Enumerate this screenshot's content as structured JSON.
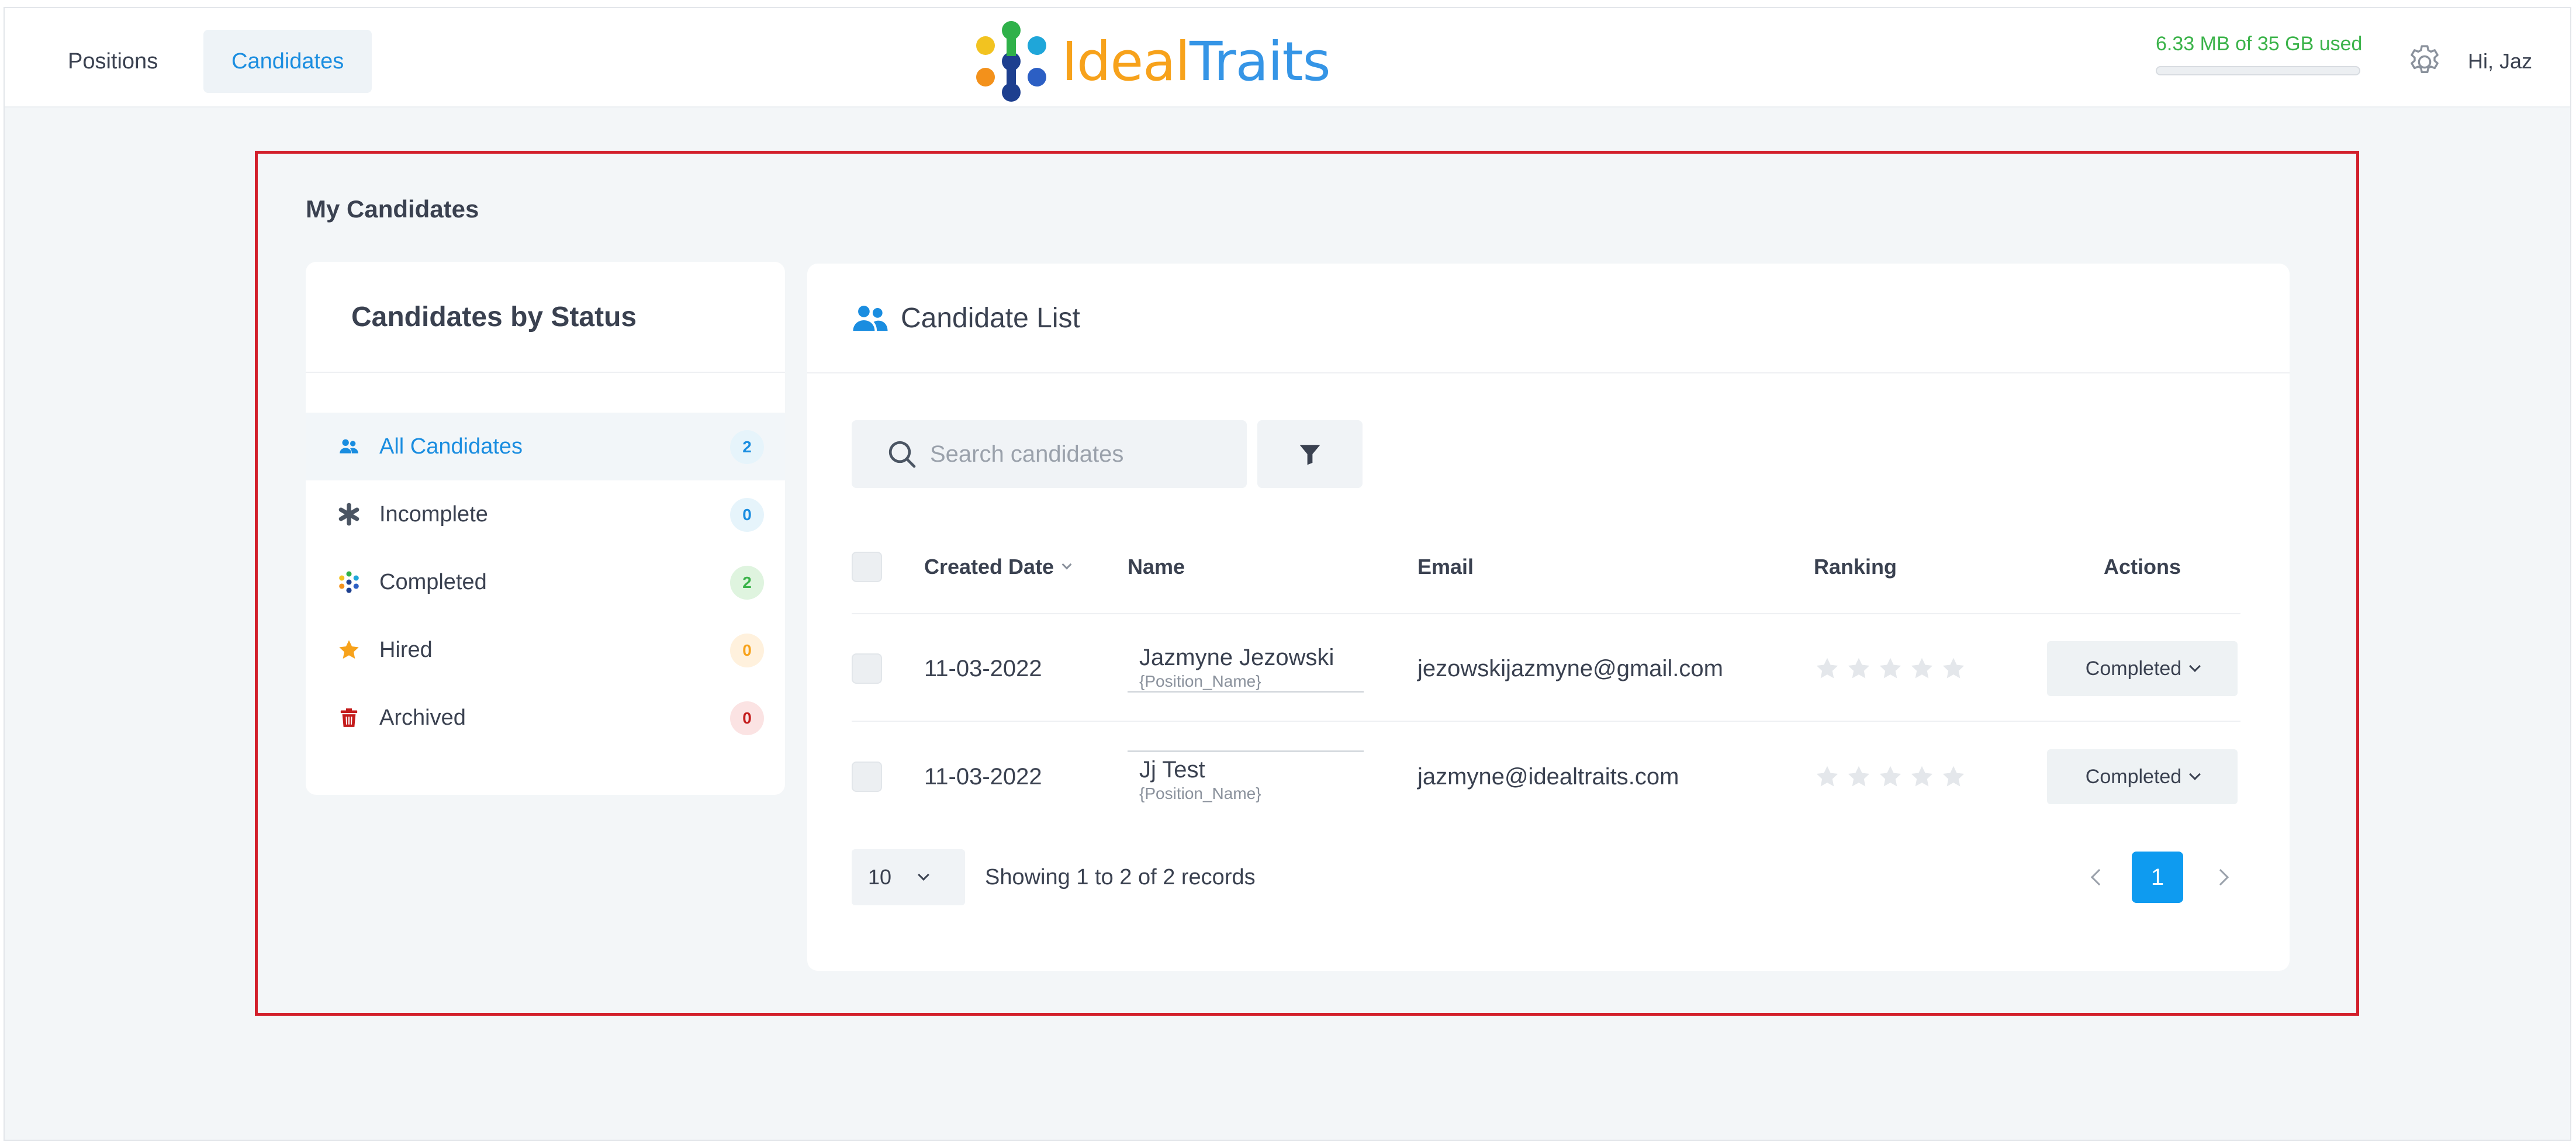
{
  "nav": {
    "positions_label": "Positions",
    "candidates_label": "Candidates"
  },
  "logo": {
    "word1": "Ideal",
    "word2": "Traits"
  },
  "storage": {
    "text": "6.33 MB of 35 GB used",
    "used_fraction": 0.0002
  },
  "user": {
    "greeting": "Hi, Jaz"
  },
  "page": {
    "title": "My Candidates"
  },
  "status_panel": {
    "title": "Candidates by Status",
    "items": [
      {
        "label": "All Candidates",
        "count": "2",
        "icon": "users-icon"
      },
      {
        "label": "Incomplete",
        "count": "0",
        "icon": "asterisk-icon"
      },
      {
        "label": "Completed",
        "count": "2",
        "icon": "flower-icon"
      },
      {
        "label": "Hired",
        "count": "0",
        "icon": "star-icon"
      },
      {
        "label": "Archived",
        "count": "0",
        "icon": "trash-icon"
      }
    ]
  },
  "candidate_list": {
    "title": "Candidate List",
    "search_placeholder": "Search candidates",
    "columns": {
      "created_date": "Created Date",
      "name": "Name",
      "email": "Email",
      "ranking": "Ranking",
      "actions": "Actions"
    },
    "rows": [
      {
        "date": "11-03-2022",
        "name": "Jazmyne Jezowski",
        "position": "{Position_Name}",
        "email": "jezowskijazmyne@gmail.com",
        "ranking": 0,
        "action": "Completed"
      },
      {
        "date": "11-03-2022",
        "name": "Jj Test",
        "position": "{Position_Name}",
        "email": "jazmyne@idealtraits.com",
        "ranking": 0,
        "action": "Completed"
      }
    ],
    "page_size": "10",
    "showing": "Showing 1 to 2 of 2 records",
    "current_page": "1"
  },
  "colors": {
    "accent_blue": "#1a8de0",
    "storage_green": "#3bb34a",
    "highlight_red": "#d21f2b",
    "logo_orange": "#f7a21b"
  }
}
